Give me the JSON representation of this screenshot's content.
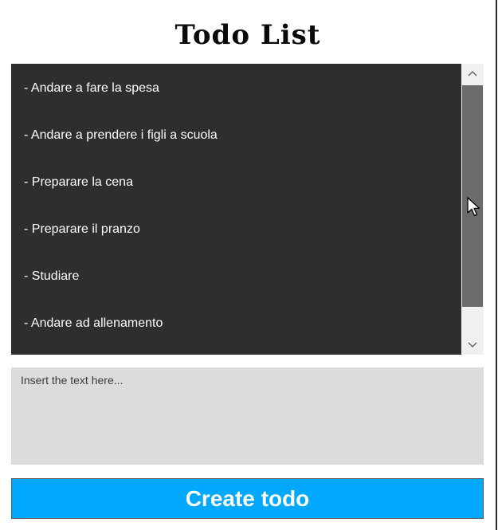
{
  "app": {
    "title": "Todo List"
  },
  "todos": [
    {
      "label": "- Andare a fare la spesa"
    },
    {
      "label": "- Andare a prendere i figli a scuola"
    },
    {
      "label": "- Preparare la cena"
    },
    {
      "label": "- Preparare il pranzo"
    },
    {
      "label": "- Studiare"
    },
    {
      "label": "- Andare ad allenamento"
    }
  ],
  "scrollbar": {
    "up_icon": "chevron-up-icon",
    "down_icon": "chevron-down-icon",
    "up_glyph": "^",
    "down_glyph": "v"
  },
  "input": {
    "value": "",
    "placeholder": "Insert the text here..."
  },
  "actions": {
    "create_label": "Create todo"
  },
  "colors": {
    "list_background": "#2e2e2e",
    "input_background": "#dcdcdc",
    "button_background": "#00a8ff",
    "button_text": "#ffffff"
  }
}
